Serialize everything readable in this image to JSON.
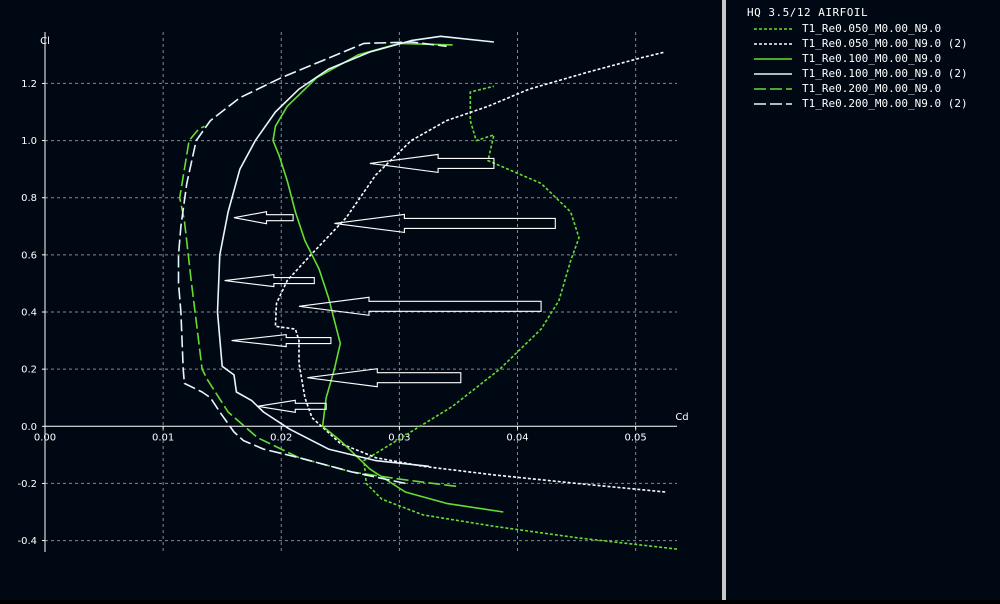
{
  "chart_data": {
    "type": "line",
    "title": "HQ 3.5/12 AIRFOIL",
    "xlabel": "Cd",
    "ylabel": "Cl",
    "xlim": [
      0,
      0.0535
    ],
    "ylim": [
      -0.44,
      1.38
    ],
    "x_ticks": [
      0.0,
      0.01,
      0.02,
      0.03,
      0.04,
      0.05
    ],
    "x_tick_labels": [
      "0.00",
      "0.01",
      "0.02",
      "0.03",
      "0.04",
      "0.05"
    ],
    "y_ticks": [
      -0.4,
      -0.2,
      0.0,
      0.2,
      0.4,
      0.6,
      0.8,
      1.0,
      1.2
    ],
    "y_tick_labels": [
      "-0.4",
      "-0.2",
      "0.0",
      "0.2",
      "0.4",
      "0.6",
      "0.8",
      "1.0",
      "1.2"
    ],
    "grid": true,
    "legend_position": "right-panel",
    "series": [
      {
        "name": "T1_Re0.050_M0.00_N9.0",
        "color": "#66dd33",
        "dash": "dotted",
        "points": [
          [
            0.0535,
            -0.43
          ],
          [
            0.045,
            -0.39
          ],
          [
            0.038,
            -0.35
          ],
          [
            0.032,
            -0.31
          ],
          [
            0.0285,
            -0.255
          ],
          [
            0.0272,
            -0.2
          ],
          [
            0.027,
            -0.12
          ],
          [
            0.0345,
            0.07
          ],
          [
            0.0385,
            0.2
          ],
          [
            0.042,
            0.34
          ],
          [
            0.0435,
            0.44
          ],
          [
            0.0445,
            0.58
          ],
          [
            0.0452,
            0.66
          ],
          [
            0.0445,
            0.75
          ],
          [
            0.042,
            0.85
          ],
          [
            0.0375,
            0.93
          ],
          [
            0.038,
            1.02
          ],
          [
            0.0365,
            1.0
          ],
          [
            0.036,
            1.07
          ],
          [
            0.036,
            1.17
          ],
          [
            0.038,
            1.19
          ]
        ]
      },
      {
        "name": "T1_Re0.050_M0.00_N9.0 (2)",
        "color": "#ffffff",
        "dash": "dotted",
        "points": [
          [
            0.0525,
            -0.23
          ],
          [
            0.045,
            -0.2
          ],
          [
            0.038,
            -0.17
          ],
          [
            0.032,
            -0.14
          ],
          [
            0.028,
            -0.11
          ],
          [
            0.025,
            -0.06
          ],
          [
            0.0226,
            0.03
          ],
          [
            0.022,
            0.1
          ],
          [
            0.0215,
            0.22
          ],
          [
            0.0215,
            0.3
          ],
          [
            0.0212,
            0.34
          ],
          [
            0.0195,
            0.35
          ],
          [
            0.0196,
            0.43
          ],
          [
            0.0205,
            0.51
          ],
          [
            0.0225,
            0.6
          ],
          [
            0.0255,
            0.73
          ],
          [
            0.028,
            0.88
          ],
          [
            0.031,
            1.0
          ],
          [
            0.034,
            1.07
          ],
          [
            0.0375,
            1.12
          ],
          [
            0.041,
            1.18
          ],
          [
            0.046,
            1.24
          ],
          [
            0.0505,
            1.29
          ],
          [
            0.0525,
            1.31
          ]
        ]
      },
      {
        "name": "T1_Re0.100_M0.00_N9.0",
        "color": "#66dd33",
        "dash": "solid",
        "points": [
          [
            0.0388,
            -0.3
          ],
          [
            0.034,
            -0.27
          ],
          [
            0.0305,
            -0.23
          ],
          [
            0.0275,
            -0.15
          ],
          [
            0.025,
            -0.05
          ],
          [
            0.0235,
            0.0
          ],
          [
            0.0238,
            0.1
          ],
          [
            0.0245,
            0.2
          ],
          [
            0.025,
            0.29
          ],
          [
            0.0245,
            0.37
          ],
          [
            0.024,
            0.45
          ],
          [
            0.0232,
            0.55
          ],
          [
            0.022,
            0.65
          ],
          [
            0.0212,
            0.75
          ],
          [
            0.0205,
            0.86
          ],
          [
            0.0198,
            0.95
          ],
          [
            0.0193,
            1.0
          ],
          [
            0.0195,
            1.05
          ],
          [
            0.0205,
            1.12
          ],
          [
            0.023,
            1.22
          ],
          [
            0.0265,
            1.3
          ],
          [
            0.03,
            1.34
          ],
          [
            0.0345,
            1.335
          ]
        ]
      },
      {
        "name": "T1_Re0.100_M0.00_N9.0 (2)",
        "color": "#e8f6ff",
        "dash": "solid",
        "points": [
          [
            0.0325,
            -0.14
          ],
          [
            0.028,
            -0.12
          ],
          [
            0.024,
            -0.08
          ],
          [
            0.0207,
            -0.01
          ],
          [
            0.0185,
            0.05
          ],
          [
            0.0175,
            0.09
          ],
          [
            0.0162,
            0.12
          ],
          [
            0.016,
            0.18
          ],
          [
            0.015,
            0.21
          ],
          [
            0.0146,
            0.4
          ],
          [
            0.0148,
            0.6
          ],
          [
            0.0155,
            0.75
          ],
          [
            0.0165,
            0.9
          ],
          [
            0.0178,
            1.0
          ],
          [
            0.0195,
            1.1
          ],
          [
            0.0215,
            1.18
          ],
          [
            0.024,
            1.25
          ],
          [
            0.0275,
            1.31
          ],
          [
            0.031,
            1.35
          ],
          [
            0.0335,
            1.365
          ],
          [
            0.038,
            1.345
          ]
        ]
      },
      {
        "name": "T1_Re0.200_M0.00_N9.0",
        "color": "#66dd33",
        "dash": "dashed",
        "points": [
          [
            0.0348,
            -0.21
          ],
          [
            0.03,
            -0.185
          ],
          [
            0.026,
            -0.16
          ],
          [
            0.0215,
            -0.11
          ],
          [
            0.018,
            -0.04
          ],
          [
            0.0155,
            0.05
          ],
          [
            0.0138,
            0.16
          ],
          [
            0.0133,
            0.2
          ],
          [
            0.013,
            0.3
          ],
          [
            0.0124,
            0.5
          ],
          [
            0.0118,
            0.72
          ],
          [
            0.0114,
            0.8
          ],
          [
            0.0118,
            0.9
          ],
          [
            0.0122,
            1.0
          ],
          [
            0.013,
            1.04
          ],
          [
            0.0135,
            1.05
          ]
        ]
      },
      {
        "name": "T1_Re0.200_M0.00_N9.0 (2)",
        "color": "#e8f6ff",
        "dash": "dashed",
        "points": [
          [
            0.0305,
            -0.2
          ],
          [
            0.026,
            -0.16
          ],
          [
            0.0215,
            -0.11
          ],
          [
            0.0185,
            -0.08
          ],
          [
            0.0168,
            -0.05
          ],
          [
            0.016,
            -0.02
          ],
          [
            0.0148,
            0.05
          ],
          [
            0.014,
            0.1
          ],
          [
            0.0133,
            0.12
          ],
          [
            0.0118,
            0.15
          ],
          [
            0.0117,
            0.2
          ],
          [
            0.0115,
            0.4
          ],
          [
            0.0113,
            0.5
          ],
          [
            0.0113,
            0.6
          ],
          [
            0.0115,
            0.7
          ],
          [
            0.012,
            0.85
          ],
          [
            0.0128,
            1.0
          ],
          [
            0.014,
            1.07
          ],
          [
            0.0165,
            1.15
          ],
          [
            0.02,
            1.22
          ],
          [
            0.0235,
            1.28
          ],
          [
            0.027,
            1.34
          ],
          [
            0.031,
            1.345
          ],
          [
            0.034,
            1.33
          ]
        ]
      }
    ],
    "annotations": [
      {
        "type": "arrow",
        "from": [
          0.038,
          0.92
        ],
        "to": [
          0.0275,
          0.92
        ]
      },
      {
        "type": "arrow",
        "from": [
          0.0432,
          0.71
        ],
        "to": [
          0.0245,
          0.71
        ]
      },
      {
        "type": "arrow",
        "from": [
          0.021,
          0.73
        ],
        "to": [
          0.016,
          0.73
        ]
      },
      {
        "type": "arrow",
        "from": [
          0.0228,
          0.51
        ],
        "to": [
          0.0152,
          0.51
        ]
      },
      {
        "type": "arrow",
        "from": [
          0.042,
          0.42
        ],
        "to": [
          0.0215,
          0.42
        ]
      },
      {
        "type": "arrow",
        "from": [
          0.0242,
          0.3
        ],
        "to": [
          0.0158,
          0.3
        ]
      },
      {
        "type": "arrow",
        "from": [
          0.0352,
          0.17
        ],
        "to": [
          0.0222,
          0.17
        ]
      },
      {
        "type": "arrow",
        "from": [
          0.0238,
          0.07
        ],
        "to": [
          0.018,
          0.07
        ]
      }
    ]
  }
}
